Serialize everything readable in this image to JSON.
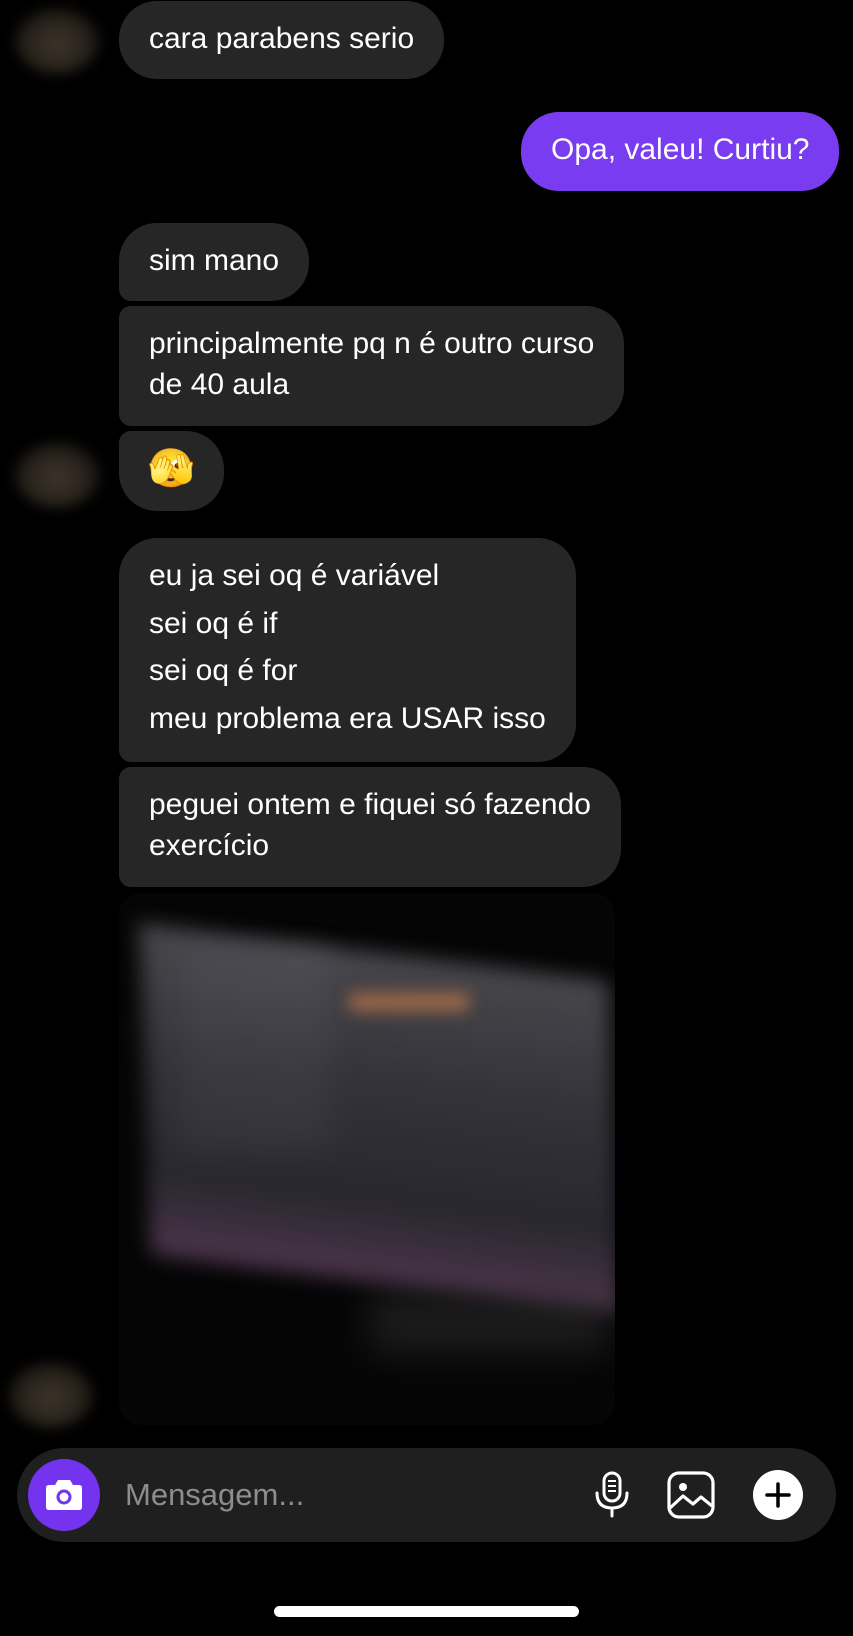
{
  "messages": [
    {
      "text": "cara parabens serio"
    },
    {
      "text": "Opa, valeu! Curtiu?"
    },
    {
      "text": "sim mano"
    },
    {
      "lines": [
        "principalmente pq n é outro curso",
        "de 40 aula"
      ]
    },
    {
      "text": "🫣"
    },
    {
      "lines": [
        "eu ja sei oq é variável",
        "sei oq é if",
        "sei oq é for",
        "meu problema era USAR isso"
      ]
    },
    {
      "lines": [
        "peguei ontem e fiquei só fazendo",
        "exercício"
      ]
    }
  ],
  "composer": {
    "placeholder": "Mensagem...",
    "icons": {
      "camera": "camera-icon",
      "mic": "microphone-icon",
      "gallery": "image-icon",
      "plus": "plus-icon"
    }
  },
  "colors": {
    "background": "#000000",
    "received_bubble": "#262626",
    "sent_bubble": "#7a3cf0",
    "accent": "#7433ef"
  }
}
